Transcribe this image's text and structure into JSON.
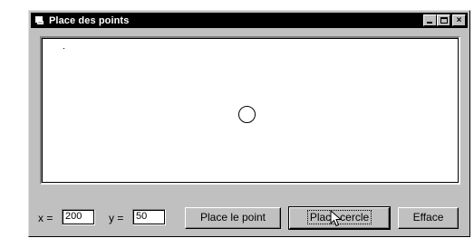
{
  "window": {
    "title": "Place des points",
    "icon": "app-window-icon",
    "caption_buttons": [
      "minimize-icon",
      "maximize-icon",
      "close-icon"
    ],
    "close_glyph": "×"
  },
  "form": {
    "x_label": "x =",
    "x_value": "200",
    "y_label": "y =",
    "y_value": "50"
  },
  "buttons": {
    "place_point": "Place le point",
    "place_circle_part1": "Place",
    "place_circle_part2": " cercle",
    "erase": "Efface"
  },
  "colors": {
    "titlebar": "#000000",
    "face": "#c0c0c0",
    "canvas": "#ffffff"
  }
}
